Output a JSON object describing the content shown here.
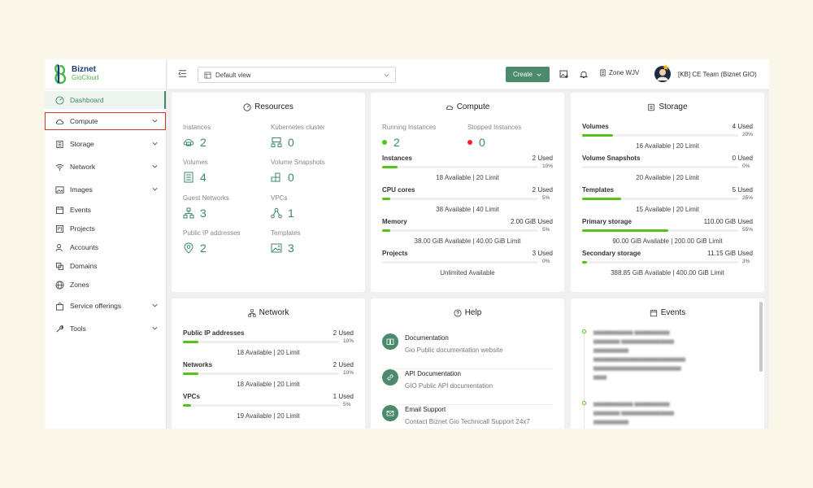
{
  "brand": {
    "name_line1": "Biznet",
    "name_line2": "GioCloud"
  },
  "sidebar": {
    "items": [
      {
        "label": "Dashboard",
        "icon": "dashboard-icon"
      },
      {
        "label": "Compute",
        "icon": "cloud-icon"
      },
      {
        "label": "Storage",
        "icon": "storage-icon"
      },
      {
        "label": "Network",
        "icon": "wifi-icon"
      },
      {
        "label": "Images",
        "icon": "image-icon"
      },
      {
        "label": "Events",
        "icon": "calendar-icon"
      },
      {
        "label": "Projects",
        "icon": "project-icon"
      },
      {
        "label": "Accounts",
        "icon": "user-icon"
      },
      {
        "label": "Domains",
        "icon": "domain-icon"
      },
      {
        "label": "Zones",
        "icon": "globe-icon"
      },
      {
        "label": "Service offerings",
        "icon": "shopping-icon"
      },
      {
        "label": "Tools",
        "icon": "tool-icon"
      }
    ]
  },
  "header": {
    "view_select": "Default view",
    "create_label": "Create",
    "zone_label": "Zone WJV",
    "team_label": "[KB] CE Team (Biznet GIO)"
  },
  "resources": {
    "title": "Resources",
    "items": [
      {
        "label": "Instances",
        "value": "2"
      },
      {
        "label": "Kubernetes cluster",
        "value": "0"
      },
      {
        "label": "Volumes",
        "value": "4"
      },
      {
        "label": "Volume Snapshots",
        "value": "0"
      },
      {
        "label": "Guest Networks",
        "value": "3"
      },
      {
        "label": "VPCs",
        "value": "1"
      },
      {
        "label": "Public IP addresses",
        "value": "2"
      },
      {
        "label": "Templates",
        "value": "3"
      }
    ]
  },
  "compute": {
    "title": "Compute",
    "running_label": "Running Instances",
    "running_value": "2",
    "stopped_label": "Stopped Instances",
    "stopped_value": "0",
    "usage": [
      {
        "name": "Instances",
        "used": "2 Used",
        "pct": "10%",
        "fill": 0.1,
        "avail": "18 Available | 20 Limit"
      },
      {
        "name": "CPU cores",
        "used": "2 Used",
        "pct": "5%",
        "fill": 0.05,
        "avail": "38 Available | 40 Limit"
      },
      {
        "name": "Memory",
        "used": "2.00 GiB Used",
        "pct": "5%",
        "fill": 0.05,
        "avail": "38.00 GiB Available | 40.00 GiB Limit"
      },
      {
        "name": "Projects",
        "used": "3 Used",
        "pct": "0%",
        "fill": 0.0,
        "avail": "Unlimited Available"
      }
    ]
  },
  "storage": {
    "title": "Storage",
    "usage": [
      {
        "name": "Volumes",
        "used": "4 Used",
        "pct": "20%",
        "fill": 0.2,
        "avail": "16 Available | 20 Limit"
      },
      {
        "name": "Volume Snapshots",
        "used": "0 Used",
        "pct": "0%",
        "fill": 0.0,
        "avail": "20 Available | 20 Limit"
      },
      {
        "name": "Templates",
        "used": "5 Used",
        "pct": "25%",
        "fill": 0.25,
        "avail": "15 Available | 20 Limit"
      },
      {
        "name": "Primary storage",
        "used": "110.00 GiB Used",
        "pct": "55%",
        "fill": 0.55,
        "avail": "90.00 GiB Available | 200.00 GiB Limit"
      },
      {
        "name": "Secondary storage",
        "used": "11.15 GiB Used",
        "pct": "3%",
        "fill": 0.03,
        "avail": "388.85 GiB Available | 400.00 GiB Limit"
      }
    ]
  },
  "network": {
    "title": "Network",
    "usage": [
      {
        "name": "Public IP addresses",
        "used": "2 Used",
        "pct": "10%",
        "fill": 0.1,
        "avail": "18 Available | 20 Limit"
      },
      {
        "name": "Networks",
        "used": "2 Used",
        "pct": "10%",
        "fill": 0.1,
        "avail": "18 Available | 20 Limit"
      },
      {
        "name": "VPCs",
        "used": "1 Used",
        "pct": "5%",
        "fill": 0.05,
        "avail": "19 Available | 20 Limit"
      }
    ]
  },
  "help": {
    "title": "Help",
    "items": [
      {
        "title": "Documentation",
        "desc": "Gio Public documentation website",
        "icon": "book-icon"
      },
      {
        "title": "API Documentation",
        "desc": "GIO Public API documentation",
        "icon": "link-icon"
      },
      {
        "title": "Email Support",
        "desc": "Contact Biznet Gio Technicall Support 24x7",
        "icon": "mail-icon"
      }
    ]
  },
  "events": {
    "title": "Events"
  },
  "colors": {
    "accent": "#3e8a63",
    "bar": "#52c41a",
    "running": "#52c41a",
    "stopped": "#f5222d",
    "highlight": "#d9312b"
  }
}
